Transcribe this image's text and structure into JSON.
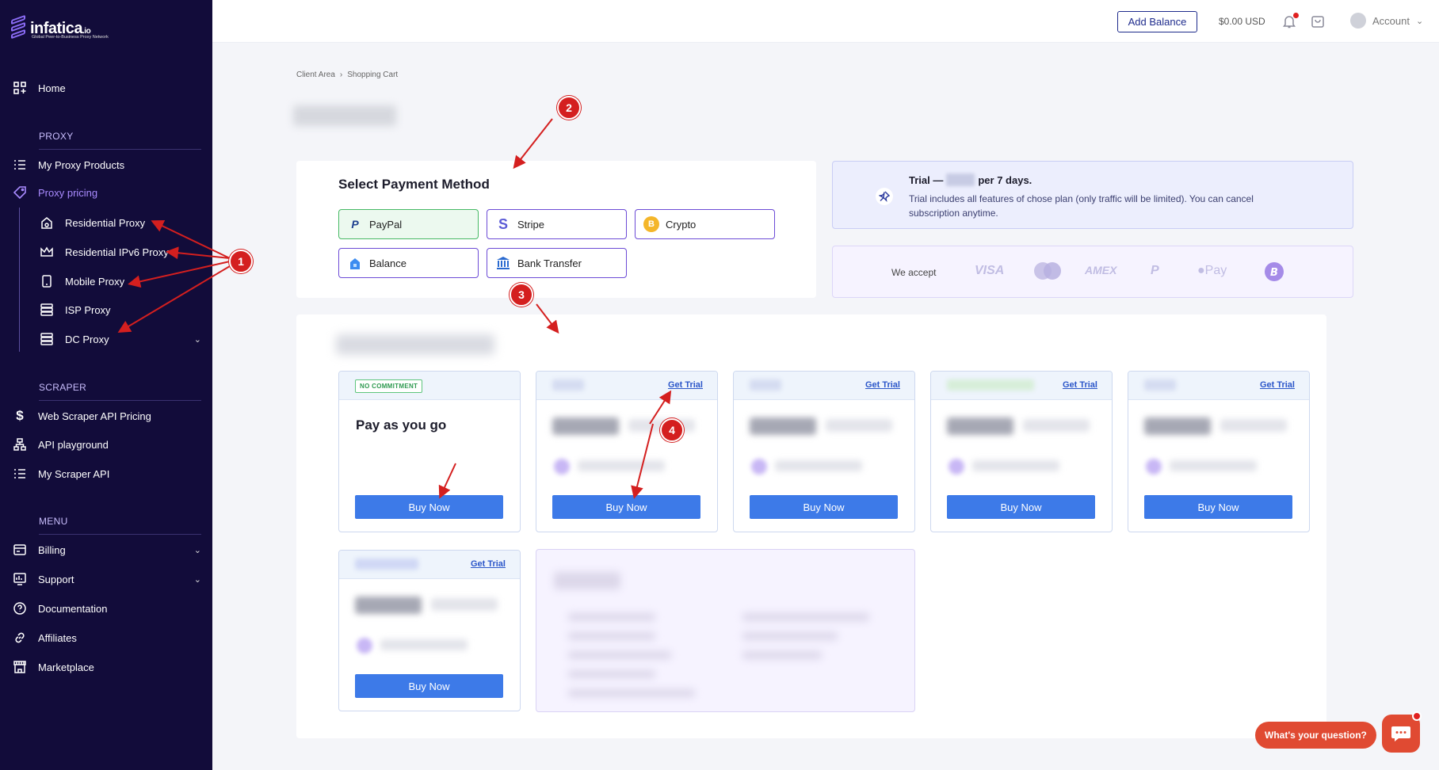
{
  "sidebar": {
    "logo_text": "infatica",
    "logo_suffix": ".io",
    "logo_tagline": "Global Peer-to-Business Proxy Network",
    "home": "Home",
    "proxy_section": "PROXY",
    "my_proxy_products": "My Proxy Products",
    "proxy_pricing": "Proxy pricing",
    "sub_items": [
      "Residential Proxy",
      "Residential IPv6 Proxy",
      "Mobile Proxy",
      "ISP Proxy",
      "DC Proxy"
    ],
    "scraper_section": "SCRAPER",
    "web_scraper_pricing": "Web Scraper API Pricing",
    "api_playground": "API playground",
    "my_scraper_api": "My Scraper API",
    "menu_section": "MENU",
    "billing": "Billing",
    "support": "Support",
    "documentation": "Documentation",
    "affiliates": "Affiliates",
    "marketplace": "Marketplace"
  },
  "topbar": {
    "add_balance": "Add Balance",
    "balance": "$0.00 USD",
    "account": "Account"
  },
  "breadcrumb": [
    "Client Area",
    "Shopping Cart"
  ],
  "payment": {
    "title": "Select Payment Method",
    "methods": [
      "PayPal",
      "Stripe",
      "Crypto",
      "Balance",
      "Bank Transfer"
    ],
    "selected": "PayPal"
  },
  "trial": {
    "title_prefix": "Trial —",
    "title_suffix": "per 7 days.",
    "text": "Trial includes all features of chose plan (only traffic will be limited). You can cancel subscription anytime."
  },
  "accept": {
    "label": "We accept",
    "logos": [
      "VISA",
      "AMEX",
      "Pay"
    ]
  },
  "plans": {
    "no_commitment": "NO COMMITMENT",
    "pay_as_you_go": "Pay as you go",
    "get_trial": "Get Trial",
    "buy_now": "Buy Now"
  },
  "annotations": [
    "1",
    "2",
    "3",
    "4"
  ],
  "chat": {
    "question": "What's your question?"
  },
  "colors": {
    "sidebar_bg": "#120c3a",
    "accent": "#a98bff",
    "button_blue": "#3d7ae8",
    "annotation_red": "#d41f1f"
  }
}
